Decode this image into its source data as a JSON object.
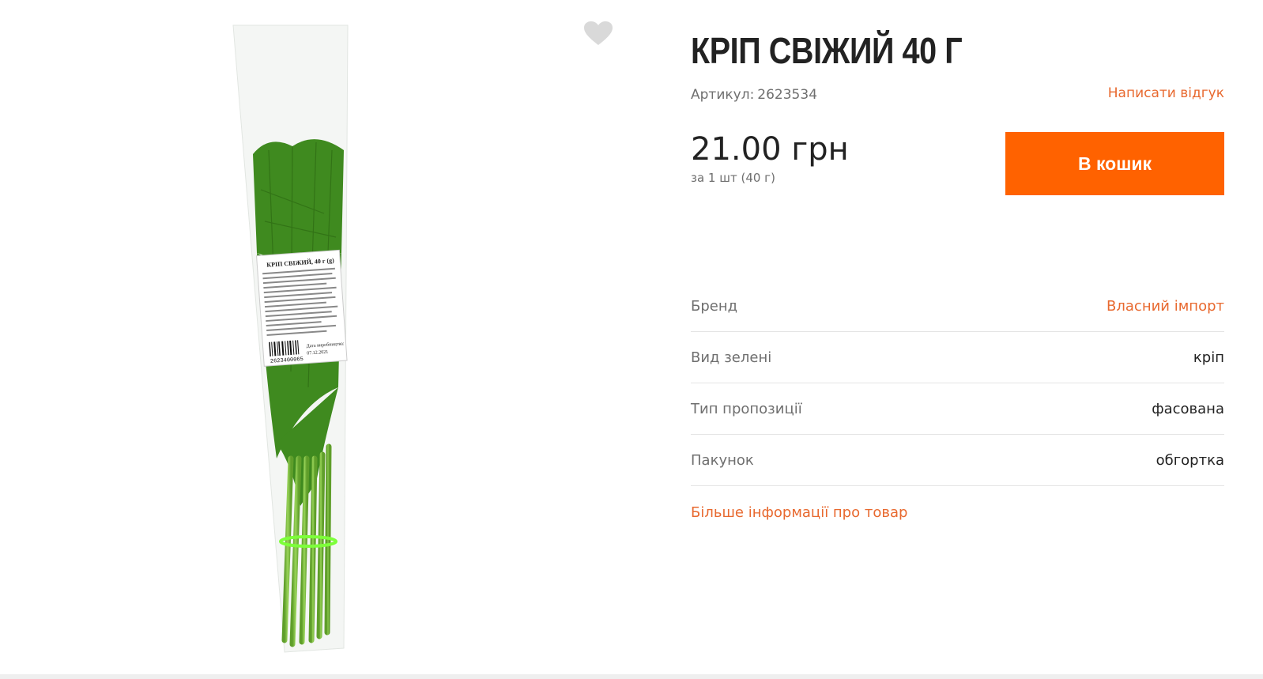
{
  "product": {
    "title": "КРІП СВІЖИЙ 40 Г",
    "sku_label": "Артикул:",
    "sku_value": "2623534",
    "review_link": "Написати відгук",
    "price": "21.00 грн",
    "price_unit": "за 1 шт (40 г)",
    "cart_button": "В кошик"
  },
  "specs": [
    {
      "label": "Бренд",
      "value": "Власний імпорт"
    },
    {
      "label": "Вид зелені",
      "value": "кріп"
    },
    {
      "label": "Тип пропозиції",
      "value": "фасована"
    },
    {
      "label": "Пакунок",
      "value": "обгортка"
    }
  ],
  "more_info_link": "Більше інформації про товар",
  "image_label": {
    "title": "КРІП СВІЖИЙ, 40 г (g)",
    "barcode_digits": "2623400065",
    "date_label": "Дата виробництва:",
    "date_value": "07.12.2021"
  },
  "colors": {
    "accent": "#ff6200",
    "link": "#e8692f",
    "muted_text": "#6f6f6f",
    "divider": "#e4e4e4"
  },
  "icons": {
    "wishlist": "heart-icon"
  }
}
